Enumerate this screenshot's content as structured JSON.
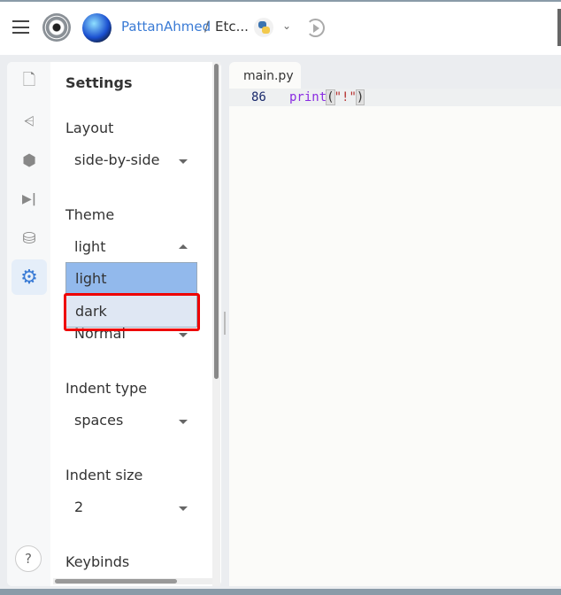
{
  "topbar": {
    "user": "PattanAhmed",
    "separator": "/",
    "project": "Etc...",
    "chevron": "⌄"
  },
  "rail": {
    "items": [
      {
        "icon": "file-icon",
        "glyph": "🗋"
      },
      {
        "icon": "share-icon",
        "glyph": "⩤"
      },
      {
        "icon": "package-icon",
        "glyph": "⬢"
      },
      {
        "icon": "step-forward-icon",
        "glyph": "▶|"
      },
      {
        "icon": "database-icon",
        "glyph": "⛁"
      },
      {
        "icon": "gear-icon",
        "glyph": "⚙",
        "active": true
      }
    ],
    "help": "?"
  },
  "settings": {
    "title": "Settings",
    "layout": {
      "label": "Layout",
      "value": "side-by-side"
    },
    "theme": {
      "label": "Theme",
      "value": "light",
      "options": [
        "light",
        "dark"
      ],
      "highlighted": "light",
      "hovered": "dark"
    },
    "hidden_value": "Normal",
    "indent_type": {
      "label": "Indent type",
      "value": "spaces"
    },
    "indent_size": {
      "label": "Indent size",
      "value": "2"
    },
    "keybinds": {
      "label": "Keybinds"
    }
  },
  "editor": {
    "tab": "main.py",
    "line_number": "86",
    "code": {
      "fn": "print",
      "open": "(",
      "str": "\"!\"",
      "close": ")"
    }
  },
  "colors": {
    "accent": "#3a7bd5",
    "highlight": "#92b9ec",
    "annotation": "#e00000"
  }
}
